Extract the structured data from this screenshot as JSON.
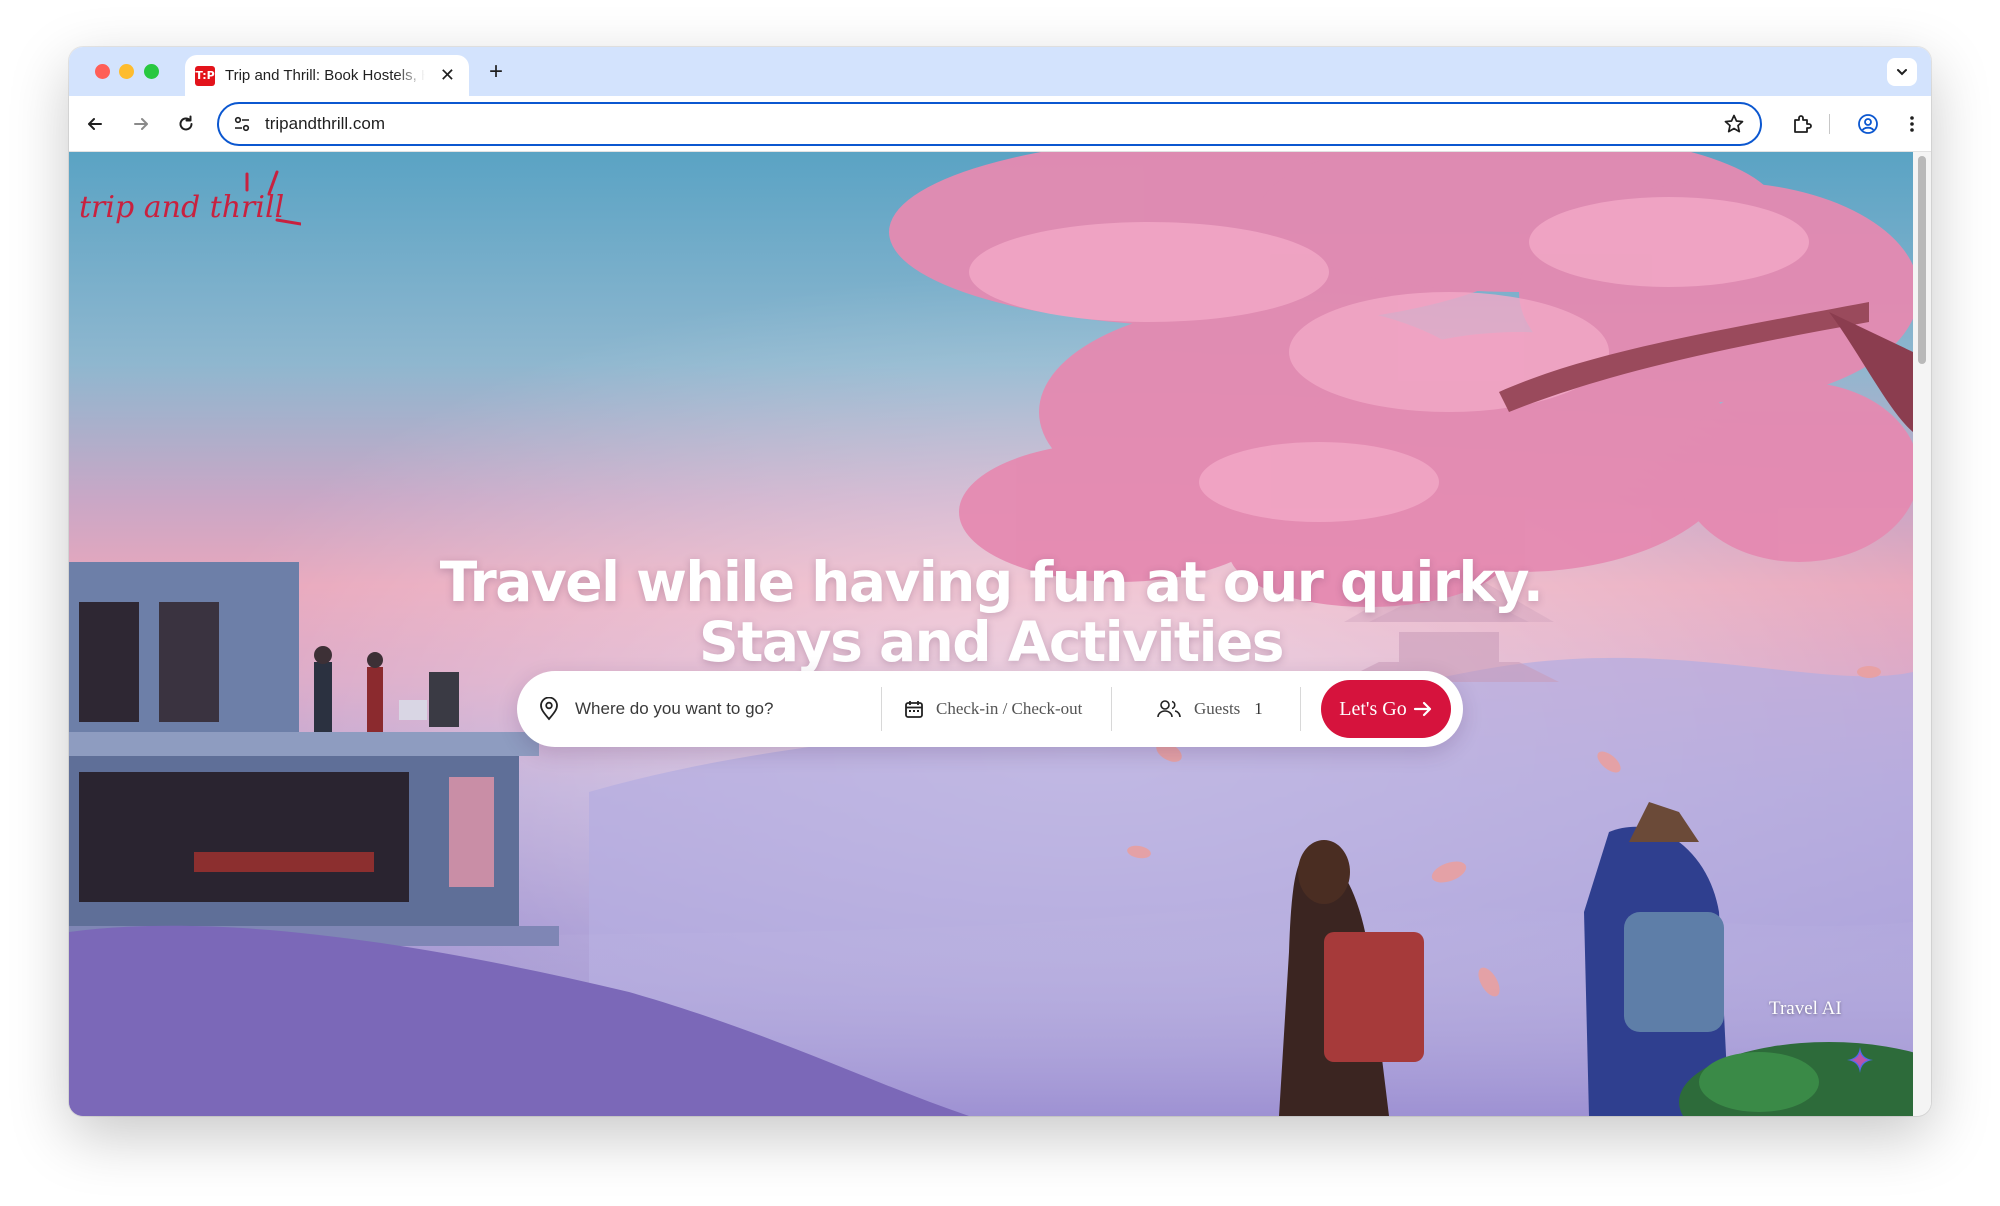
{
  "browser": {
    "tab_title": "Trip and Thrill: Book Hostels, Hotels & Activities",
    "favicon_text": "T:P",
    "new_tab_symbol": "+",
    "close_symbol": "✕",
    "url": "tripandthrill.com"
  },
  "site": {
    "logo_text": "trip and thrill",
    "headline_line1": "Travel while having fun at our quirky.",
    "headline_line2": "Stays and Activities",
    "brand_color": "#d6133d"
  },
  "search": {
    "destination_placeholder": "Where do you want to go?",
    "dates_label": "Check-in / Check-out",
    "guests_label": "Guests",
    "guests_count": "1",
    "submit_label": "Let's Go"
  },
  "assistant": {
    "label": "Travel AI"
  }
}
